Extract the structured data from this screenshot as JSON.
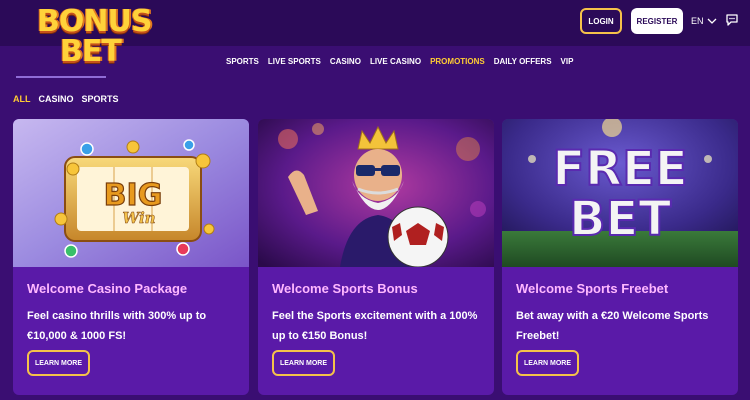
{
  "brand": {
    "line1": "BONUS",
    "line2": "BET"
  },
  "header": {
    "login_label": "LOGIN",
    "register_label": "REGISTER",
    "language": "EN"
  },
  "main_nav": [
    "SPORTS",
    "LIVE SPORTS",
    "CASINO",
    "LIVE CASINO",
    "PROMOTIONS",
    "DAILY OFFERS",
    "VIP"
  ],
  "main_nav_active": "PROMOTIONS",
  "filters": [
    "ALL",
    "CASINO",
    "SPORTS"
  ],
  "filters_active": "ALL",
  "cards": [
    {
      "title": "Welcome Casino Package",
      "desc": "Feel casino thrills with 300% up to €10,000 & 1000 FS!",
      "button": "LEARN MORE",
      "image_text_1": "BIG",
      "image_text_2": "Win"
    },
    {
      "title": "Welcome Sports Bonus",
      "desc": "Feel the Sports excitement with a 100% up to €150 Bonus!",
      "button": "LEARN MORE"
    },
    {
      "title": "Welcome Sports Freebet",
      "desc": "Bet away with a €20 Welcome Sports Freebet!",
      "button": "LEARN MORE",
      "image_text_1": "FREE",
      "image_text_2": "BET"
    }
  ],
  "colors": {
    "background": "#3a0e72",
    "header": "#2b0a58",
    "card": "#5a1aa8",
    "accent_yellow": "#ffcc33",
    "card_title": "#ffb8ff",
    "button_border": "#f5c24a"
  },
  "icons": [
    "chevron-down-icon",
    "chat-icon"
  ]
}
